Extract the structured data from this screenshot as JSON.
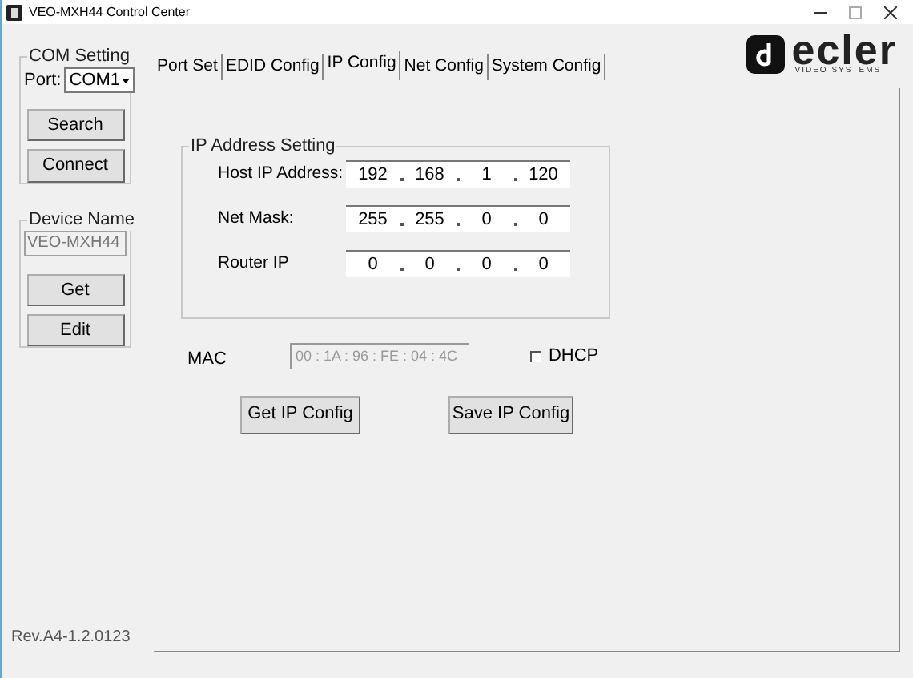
{
  "window": {
    "title": "VEO-MXH44 Control Center"
  },
  "com_setting": {
    "legend": "COM Setting",
    "port_label": "Port:",
    "port_value": "COM1",
    "buttons": [
      "Search",
      "Connect"
    ]
  },
  "device_name": {
    "legend": "Device Name",
    "value": "VEO-MXH44",
    "buttons": [
      "Get",
      "Edit"
    ]
  },
  "tabs": [
    {
      "label": "Port Set",
      "selected": false
    },
    {
      "label": "EDID Config",
      "selected": false
    },
    {
      "label": "IP Config",
      "selected": true
    },
    {
      "label": "Net Config",
      "selected": false
    },
    {
      "label": "System Config",
      "selected": false
    }
  ],
  "logo": {
    "name": "ecler",
    "tagline": "VIDEO SYSTEMS"
  },
  "ip_address_setting": {
    "legend": "IP Address Setting",
    "rows": [
      {
        "label": "Host IP Address:",
        "octets": [
          "192",
          "168",
          "1",
          "120"
        ]
      },
      {
        "label": "Net Mask:",
        "octets": [
          "255",
          "255",
          "0",
          "0"
        ]
      },
      {
        "label": "Router IP",
        "octets": [
          "0",
          "0",
          "0",
          "0"
        ]
      }
    ]
  },
  "mac": {
    "label": "MAC",
    "value": "00 : 1A : 96 : FE : 04 : 4C"
  },
  "dhcp": {
    "label": "DHCP",
    "checked": false
  },
  "buttons": [
    "Get IP Config",
    "Save IP Config"
  ],
  "revision": "Rev.A4-1.2.0123"
}
